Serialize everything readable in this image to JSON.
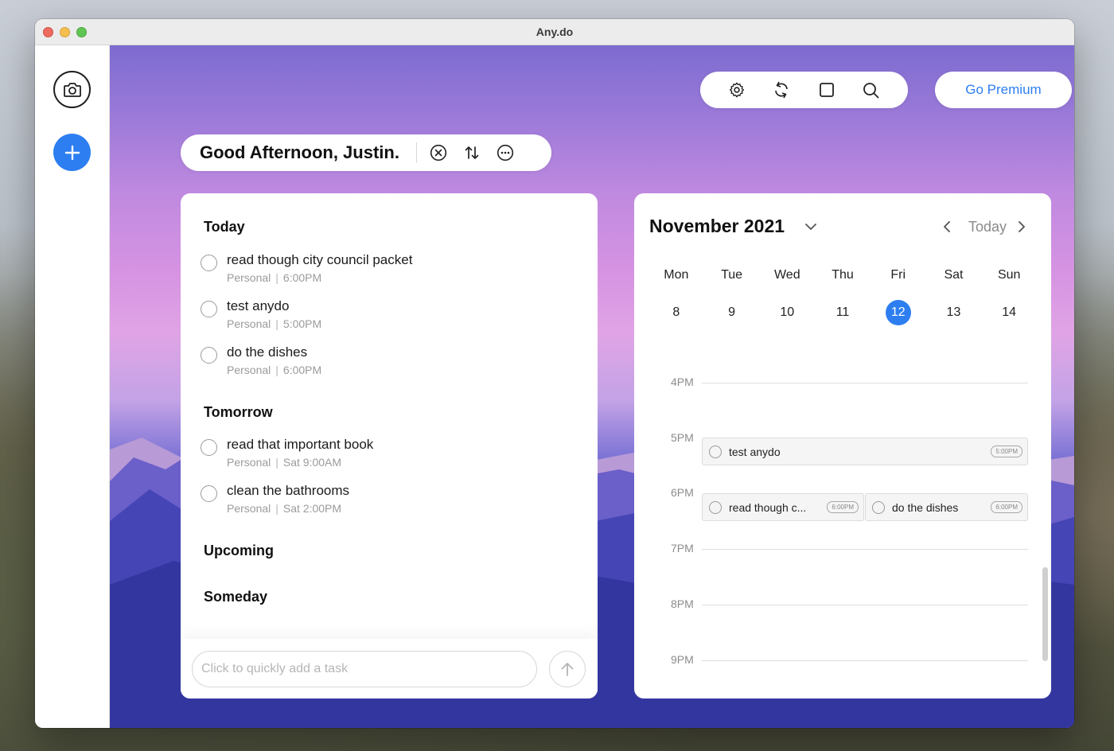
{
  "window": {
    "title": "Any.do"
  },
  "sidebar": {
    "camera_icon": "camera-icon",
    "add_icon": "plus-icon"
  },
  "toolbar": {
    "icons": [
      "gear-icon",
      "sync-icon",
      "square-icon",
      "search-icon"
    ],
    "premium_label": "Go Premium"
  },
  "header": {
    "greeting": "Good Afternoon, Justin.",
    "icons": [
      "close-circle-icon",
      "sort-icon",
      "more-circle-icon"
    ]
  },
  "tasks": {
    "sections": {
      "today": "Today",
      "tomorrow": "Tomorrow",
      "upcoming": "Upcoming",
      "someday": "Someday"
    },
    "today": [
      {
        "title": "read though city council packet",
        "list": "Personal",
        "time": "6:00PM"
      },
      {
        "title": "test anydo",
        "list": "Personal",
        "time": "5:00PM"
      },
      {
        "title": "do the dishes",
        "list": "Personal",
        "time": "6:00PM"
      }
    ],
    "tomorrow": [
      {
        "title": "read that important book",
        "list": "Personal",
        "time": "Sat 9:00AM"
      },
      {
        "title": "clean the bathrooms",
        "list": "Personal",
        "time": "Sat 2:00PM"
      }
    ],
    "meta_separator": "|",
    "quick_add_placeholder": "Click to quickly add a task"
  },
  "calendar": {
    "month_label": "November 2021",
    "today_label": "Today",
    "weekdays": [
      "Mon",
      "Tue",
      "Wed",
      "Thu",
      "Fri",
      "Sat",
      "Sun"
    ],
    "dates": [
      "8",
      "9",
      "10",
      "11",
      "12",
      "13",
      "14"
    ],
    "selected_date": "12",
    "hours": [
      "4PM",
      "5PM",
      "6PM",
      "7PM",
      "8PM",
      "9PM"
    ],
    "events": [
      {
        "title": "test anydo",
        "badge": "5:00PM"
      },
      {
        "title": "read though c...",
        "badge": "6:00PM"
      },
      {
        "title": "do the dishes",
        "badge": "6:00PM"
      }
    ]
  },
  "colors": {
    "accent": "#2d7ef0"
  }
}
